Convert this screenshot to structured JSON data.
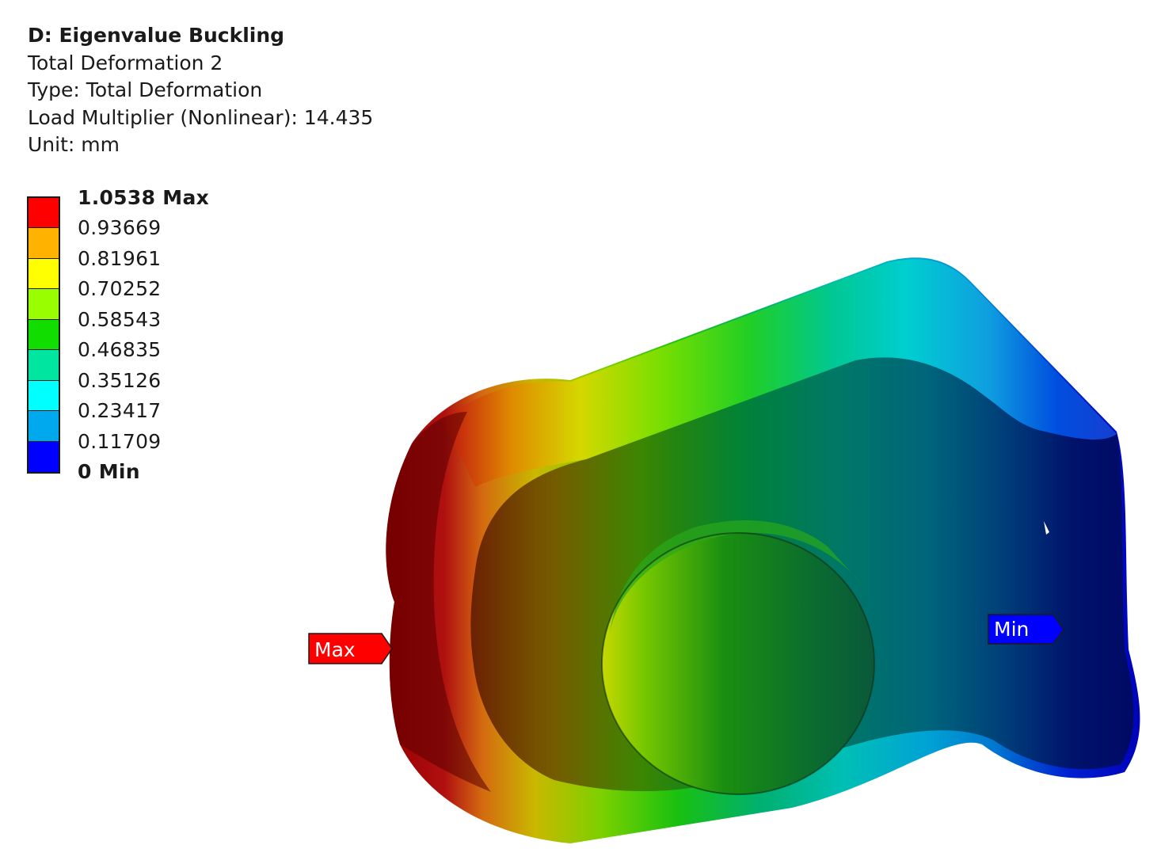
{
  "header": {
    "title": "D: Eigenvalue Buckling",
    "result_name": "Total Deformation 2",
    "type_line": "Type: Total Deformation",
    "load_multiplier_line": "Load Multiplier (Nonlinear): 14.435",
    "unit_line": "Unit: mm"
  },
  "legend": {
    "labels": [
      "1.0538 Max",
      "0.93669",
      "0.81961",
      "0.70252",
      "0.58543",
      "0.46835",
      "0.35126",
      "0.23417",
      "0.11709",
      "0 Min"
    ],
    "colors": [
      "#ff0000",
      "#ffb300",
      "#ffff00",
      "#99ff00",
      "#11dd00",
      "#00e6a0",
      "#00ffff",
      "#00a8ee",
      "#0000ff"
    ]
  },
  "probes": {
    "max_label": "Max",
    "min_label": "Min",
    "max_color": "#ff0000",
    "min_color": "#0000ff"
  }
}
